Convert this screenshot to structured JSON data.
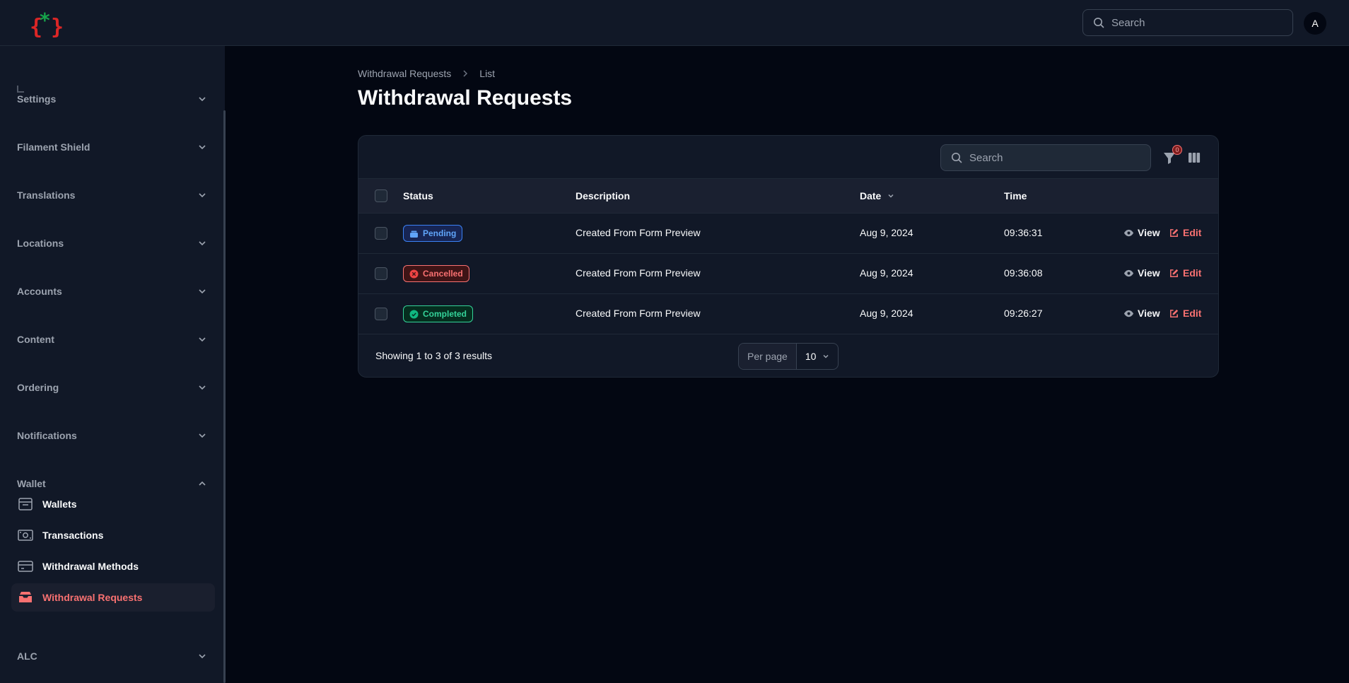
{
  "topbar": {
    "search_placeholder": "Search",
    "avatar_initial": "A"
  },
  "sidebar": {
    "groups": [
      {
        "label": "Settings",
        "expanded": false
      },
      {
        "label": "Filament Shield",
        "expanded": false
      },
      {
        "label": "Translations",
        "expanded": false
      },
      {
        "label": "Locations",
        "expanded": false
      },
      {
        "label": "Accounts",
        "expanded": false
      },
      {
        "label": "Content",
        "expanded": false
      },
      {
        "label": "Ordering",
        "expanded": false
      },
      {
        "label": "Notifications",
        "expanded": false
      },
      {
        "label": "Wallet",
        "expanded": true
      },
      {
        "label": "ALC",
        "expanded": false
      }
    ],
    "wallet_items": [
      {
        "label": "Wallets",
        "icon": "wallet-icon"
      },
      {
        "label": "Transactions",
        "icon": "cash-icon"
      },
      {
        "label": "Withdrawal Methods",
        "icon": "credit-card-icon"
      },
      {
        "label": "Withdrawal Requests",
        "icon": "inbox-stack-icon",
        "active": true
      }
    ]
  },
  "breadcrumb": {
    "parent": "Withdrawal Requests",
    "current": "List"
  },
  "page_title": "Withdrawal Requests",
  "table": {
    "search_placeholder": "Search",
    "filter_count": "0",
    "columns": [
      "Status",
      "Description",
      "Date",
      "Time"
    ],
    "sorted_column": "Date",
    "rows": [
      {
        "status": "Pending",
        "status_type": "pending",
        "description": "Created From Form Preview",
        "date": "Aug 9, 2024",
        "time": "09:36:31",
        "view": "View",
        "edit": "Edit"
      },
      {
        "status": "Cancelled",
        "status_type": "cancelled",
        "description": "Created From Form Preview",
        "date": "Aug 9, 2024",
        "time": "09:36:08",
        "view": "View",
        "edit": "Edit"
      },
      {
        "status": "Completed",
        "status_type": "completed",
        "description": "Created From Form Preview",
        "date": "Aug 9, 2024",
        "time": "09:26:27",
        "view": "View",
        "edit": "Edit"
      }
    ],
    "footer": {
      "results_text": "Showing 1 to 3 of 3 results",
      "per_page_label": "Per page",
      "per_page_value": "10"
    }
  },
  "colors": {
    "background": "#030712",
    "panel": "#111827",
    "accent": "#f87171",
    "pending": "#60a5fa",
    "cancelled": "#f87171",
    "completed": "#34d399"
  }
}
